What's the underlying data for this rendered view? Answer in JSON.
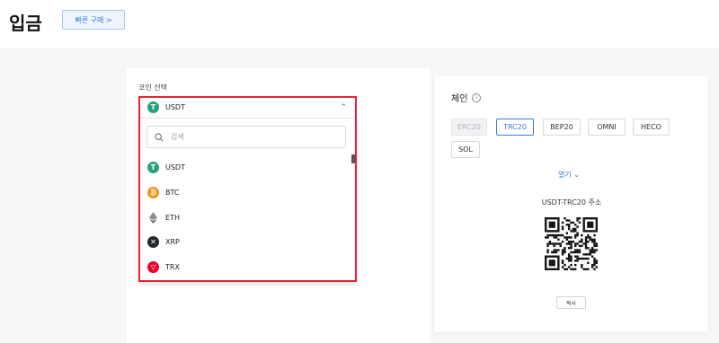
{
  "page": {
    "title": "입금",
    "quick_buy_label": "빠른 구매 >"
  },
  "coin_select": {
    "label": "코인 선택",
    "selected": "USDT",
    "search_placeholder": "검색",
    "options": [
      {
        "name": "USDT",
        "icon": "tether-icon",
        "color": "#26a17b"
      },
      {
        "name": "BTC",
        "icon": "bitcoin-icon",
        "color": "#f7931a"
      },
      {
        "name": "ETH",
        "icon": "ethereum-icon",
        "color": "#8c8c8c"
      },
      {
        "name": "XRP",
        "icon": "xrp-icon",
        "color": "#23292f"
      },
      {
        "name": "TRX",
        "icon": "tron-icon",
        "color": "#eb0029"
      }
    ]
  },
  "chain": {
    "title": "체인",
    "options": [
      {
        "label": "ERC20",
        "state": "disabled"
      },
      {
        "label": "TRC20",
        "state": "active"
      },
      {
        "label": "BEP20",
        "state": "normal"
      },
      {
        "label": "OMNI",
        "state": "normal"
      },
      {
        "label": "HECO",
        "state": "normal"
      },
      {
        "label": "SOL",
        "state": "normal"
      }
    ],
    "expand_label": "열기",
    "address_label": "USDT-TRC20 주소",
    "copy_label": "복사"
  },
  "colors": {
    "accent": "#3f7ad6",
    "highlight_border": "#e3262c"
  }
}
